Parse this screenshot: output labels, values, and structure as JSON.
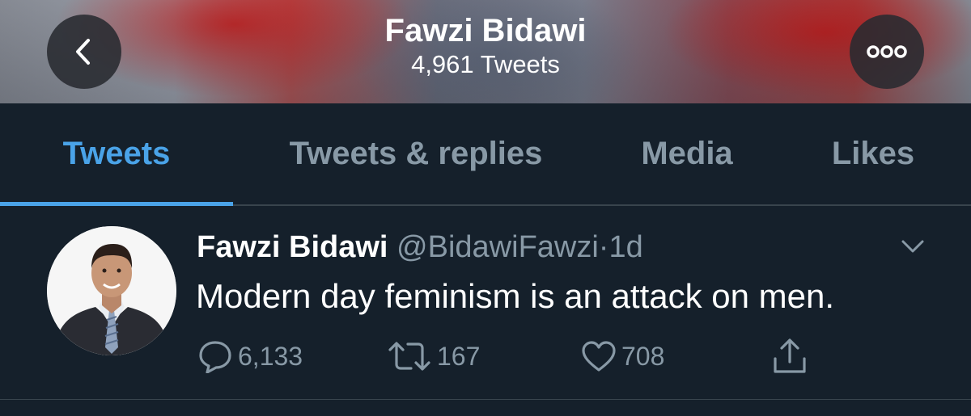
{
  "header": {
    "name": "Fawzi Bidawi",
    "tweet_count": "4,961 Tweets",
    "back_icon": "chevron-left-icon",
    "more_icon": "more-dots-icon"
  },
  "tabs": [
    {
      "label": "Tweets",
      "active": true
    },
    {
      "label": "Tweets & replies",
      "active": false
    },
    {
      "label": "Media",
      "active": false
    },
    {
      "label": "Likes",
      "active": false
    }
  ],
  "tweet": {
    "display_name": "Fawzi Bidawi",
    "handle": "@BidawiFawzi",
    "separator": "·",
    "time": "1d",
    "text": "Modern day feminism is an attack on men.",
    "replies": "6,133",
    "retweets": "167",
    "likes": "708"
  },
  "colors": {
    "background": "#15202b",
    "accent": "#4aa3e8",
    "muted": "#8899a6",
    "divider": "#38444d"
  }
}
